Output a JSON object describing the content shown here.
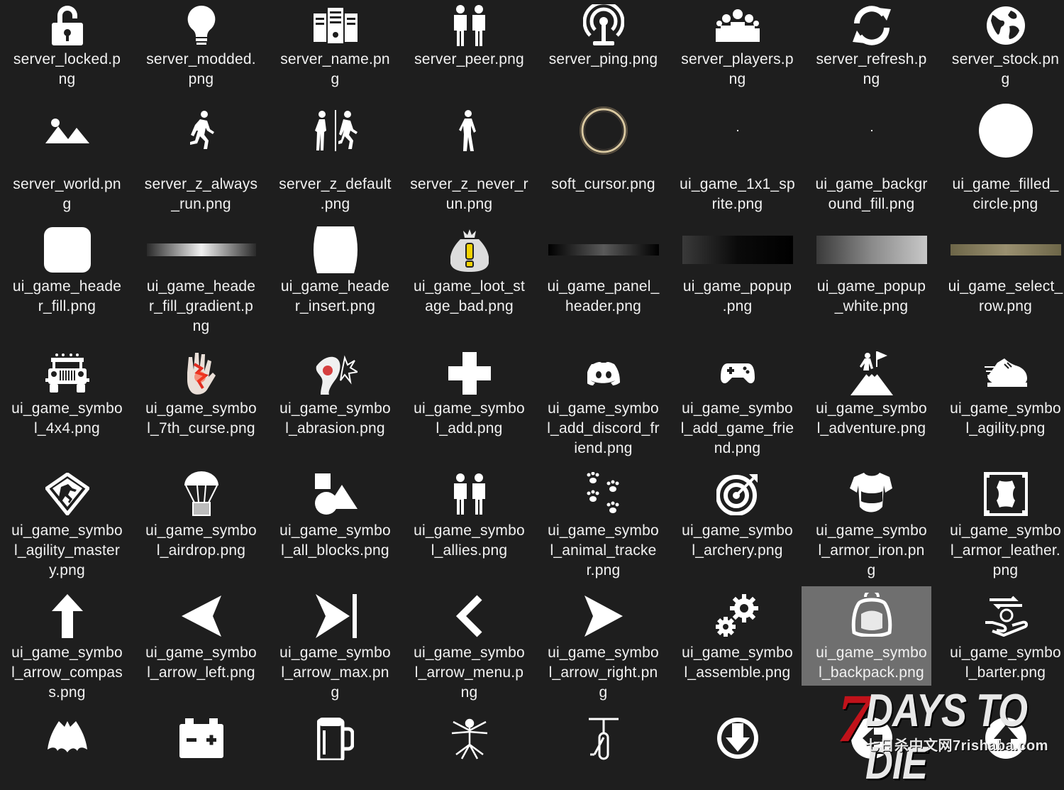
{
  "tiles": [
    {
      "file": "server_locked.png",
      "icon": "padlock-icon"
    },
    {
      "file": "server_modded.png",
      "icon": "lightbulb-icon"
    },
    {
      "file": "server_name.png",
      "icon": "server-rack-icon"
    },
    {
      "file": "server_peer.png",
      "icon": "two-people-icon"
    },
    {
      "file": "server_ping.png",
      "icon": "antenna-icon"
    },
    {
      "file": "server_players.png",
      "icon": "group-icon"
    },
    {
      "file": "server_refresh.png",
      "icon": "refresh-icon"
    },
    {
      "file": "server_stock.png",
      "icon": "globe-icon"
    },
    {
      "file": "server_world.png",
      "icon": "mountains-icon"
    },
    {
      "file": "server_z_always_run.png",
      "icon": "running-zombie-icon"
    },
    {
      "file": "server_z_default.png",
      "icon": "walk-run-zombie-icon"
    },
    {
      "file": "server_z_never_run.png",
      "icon": "walking-zombie-icon"
    },
    {
      "file": "soft_cursor.png",
      "icon": "ring-cursor-icon"
    },
    {
      "file": "ui_game_1x1_sprite.png",
      "icon": "tiny-dot-icon"
    },
    {
      "file": "ui_game_background_fill.png",
      "icon": "tiny-dot-icon"
    },
    {
      "file": "ui_game_filled_circle.png",
      "icon": "filled-circle-icon"
    },
    {
      "file": "ui_game_header_fill.png",
      "icon": "rounded-square-icon"
    },
    {
      "file": "ui_game_header_fill_gradient.png",
      "icon": "gradient-bar-icon"
    },
    {
      "file": "ui_game_header_insert.png",
      "icon": "barrel-shape-icon"
    },
    {
      "file": "ui_game_loot_stage_bad.png",
      "icon": "loot-bag-warning-icon"
    },
    {
      "file": "ui_game_panel_header.png",
      "icon": "dark-gradient-bar-icon"
    },
    {
      "file": "ui_game_popup.png",
      "icon": "dark-fade-bar-icon"
    },
    {
      "file": "ui_game_popup_white.png",
      "icon": "grey-fade-bar-icon"
    },
    {
      "file": "ui_game_select_row.png",
      "icon": "gold-bar-icon"
    },
    {
      "file": "ui_game_symbol_4x4.png",
      "icon": "jeep-icon"
    },
    {
      "file": "ui_game_symbol_7th_curse.png",
      "icon": "cursed-hand-icon"
    },
    {
      "file": "ui_game_symbol_abrasion.png",
      "icon": "abrasion-icon"
    },
    {
      "file": "ui_game_symbol_add.png",
      "icon": "plus-icon"
    },
    {
      "file": "ui_game_symbol_add_discord_friend.png",
      "icon": "discord-icon"
    },
    {
      "file": "ui_game_symbol_add_game_friend.png",
      "icon": "gamepad-icon"
    },
    {
      "file": "ui_game_symbol_adventure.png",
      "icon": "mountain-flag-icon"
    },
    {
      "file": "ui_game_symbol_agility.png",
      "icon": "running-shoe-icon"
    },
    {
      "file": "ui_game_symbol_agility_mastery.png",
      "icon": "agility-badge-icon"
    },
    {
      "file": "ui_game_symbol_airdrop.png",
      "icon": "parachute-crate-icon"
    },
    {
      "file": "ui_game_symbol_all_blocks.png",
      "icon": "shapes-icon"
    },
    {
      "file": "ui_game_symbol_allies.png",
      "icon": "two-people-icon"
    },
    {
      "file": "ui_game_symbol_animal_tracker.png",
      "icon": "paw-prints-icon"
    },
    {
      "file": "ui_game_symbol_archery.png",
      "icon": "target-arrow-icon"
    },
    {
      "file": "ui_game_symbol_armor_iron.png",
      "icon": "iron-armor-icon"
    },
    {
      "file": "ui_game_symbol_armor_leather.png",
      "icon": "leather-hide-icon"
    },
    {
      "file": "ui_game_symbol_arrow_compass.png",
      "icon": "arrow-up-icon"
    },
    {
      "file": "ui_game_symbol_arrow_left.png",
      "icon": "triangle-left-icon"
    },
    {
      "file": "ui_game_symbol_arrow_max.png",
      "icon": "skip-forward-icon"
    },
    {
      "file": "ui_game_symbol_arrow_menu.png",
      "icon": "chevron-left-icon"
    },
    {
      "file": "ui_game_symbol_arrow_right.png",
      "icon": "triangle-right-icon"
    },
    {
      "file": "ui_game_symbol_assemble.png",
      "icon": "gears-icon"
    },
    {
      "file": "ui_game_symbol_backpack.png",
      "icon": "backpack-icon"
    },
    {
      "file": "ui_game_symbol_barter.png",
      "icon": "hand-coin-icon"
    },
    {
      "file": "",
      "icon": "bat-icon"
    },
    {
      "file": "",
      "icon": "battery-icon"
    },
    {
      "file": "",
      "icon": "beer-mug-icon"
    },
    {
      "file": "",
      "icon": "vitruvian-icon"
    },
    {
      "file": "",
      "icon": "bicycle-front-icon"
    },
    {
      "file": "",
      "icon": "download-circle-icon"
    },
    {
      "file": "",
      "icon": "arrow-circle-icon"
    },
    {
      "file": "",
      "icon": "up-arrow-circle-icon"
    }
  ],
  "selected_index": 46,
  "watermark": {
    "seven": "7",
    "title": "DAYS TO DIE",
    "site": "七日杀中文网7rishaba.com"
  },
  "colors": {
    "background": "#1e1e1e",
    "selection": "#6f6f6f",
    "watermark_red": "#c1121a"
  }
}
